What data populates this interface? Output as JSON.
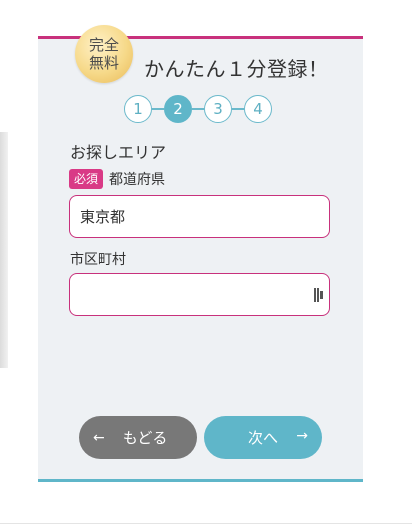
{
  "header": {
    "badge_line1": "完全",
    "badge_line2": "無料",
    "title": "かんたん１分登録！"
  },
  "stepper": {
    "steps": [
      "1",
      "2",
      "3",
      "4"
    ],
    "active_step": 2
  },
  "form": {
    "area_label": "お探しエリア",
    "required_badge": "必須",
    "prefecture_label": "都道府県",
    "prefecture_value": "東京都",
    "city_label": "市区町村",
    "city_value": ""
  },
  "buttons": {
    "back_arrow": "←",
    "back_label": "もどる",
    "next_label": "次へ",
    "next_arrow": "→"
  },
  "colors": {
    "accent_pink": "#c8317c",
    "accent_teal": "#5fb6c9",
    "back_button": "#787878",
    "card_background": "#eef1f4"
  }
}
